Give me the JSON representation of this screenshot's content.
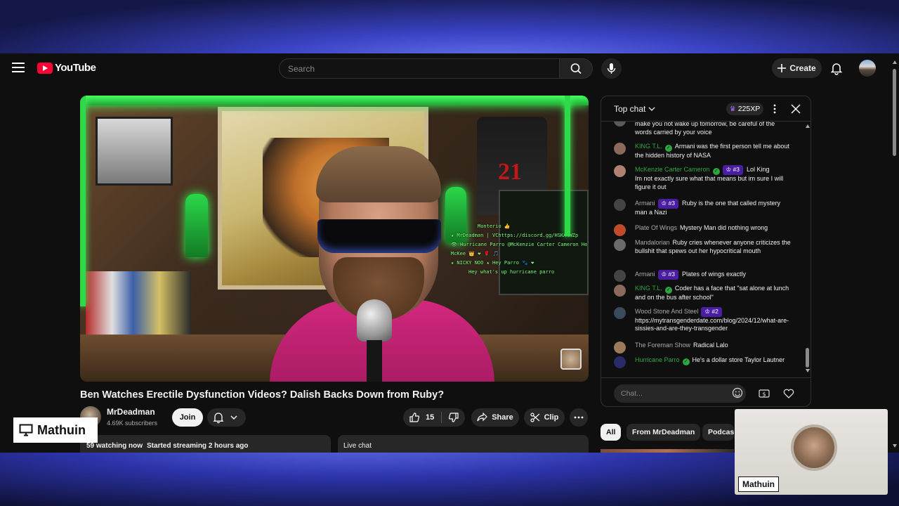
{
  "header": {
    "logo_text": "YouTube",
    "search_placeholder": "Search",
    "create_label": "Create"
  },
  "video": {
    "title": "Ben Watches Erectile Dysfunction Videos? Dalish Backs Down from Ruby?",
    "overlay_lines": [
      "Monterio 👍",
      "★ MrDeadman | VChttps://discord.gg/HSKANWZp",
      "👁 Hurricane Parro @McKenzie Carter Cameron Hello",
      "McKee 👑 ❤ 🌹 🎵",
      "★ NICKY NOO ★   Hey Parro 🐾 ❤",
      "Hey what's up hurricane parro"
    ],
    "jersey_number": "21"
  },
  "channel": {
    "name": "MrDeadman",
    "subscribers": "4.69K subscribers",
    "join_label": "Join"
  },
  "actions": {
    "likes": "15",
    "share_label": "Share",
    "clip_label": "Clip"
  },
  "description": {
    "watching": "59 watching now",
    "started": "Started streaming 2 hours ago"
  },
  "live_chat_label": "Live chat",
  "chat": {
    "mode_label": "Top chat",
    "xp": "225XP",
    "input_placeholder": "Chat...",
    "messages": [
      {
        "author": "",
        "text": "make you not wake up tomorrow, be careful of the words carried by your voice",
        "color": "#5a5a5a"
      },
      {
        "author": "KING T.L.",
        "member": true,
        "verified": true,
        "badge": "",
        "text": "Armani was the first person tell me about the hidden history of NASA",
        "color": "#8a6a5a"
      },
      {
        "author": "McKenzie Carter Cameron",
        "member": true,
        "verified": true,
        "badge": "#3",
        "text": "Lol King",
        "text2": "Im not exactly sure what that means but im sure I will figure it out",
        "color": "#b08070"
      },
      {
        "author": "Armani",
        "member": false,
        "verified": false,
        "badge": "#3",
        "text": "Ruby is the one that called mystery man a Nazi",
        "color": "#444444"
      },
      {
        "author": "Plate Of Wings",
        "member": false,
        "verified": false,
        "badge": "",
        "text": "Mystery Man did nothing wrong",
        "color": "#c04a2a"
      },
      {
        "author": "Mandalorian",
        "member": false,
        "verified": false,
        "badge": "",
        "text": "Ruby cries whenever anyone criticizes the bullshit that spews out her hypocritical mouth",
        "color": "#6a6a6a"
      },
      {
        "author": "Armani",
        "member": false,
        "verified": false,
        "badge": "#3",
        "text": "Plates of wings exactly",
        "color": "#444444"
      },
      {
        "author": "KING T.L.",
        "member": true,
        "verified": true,
        "badge": "",
        "text": "Coder has a face that \"sat alone at lunch and on the bus after school\"",
        "color": "#8a6a5a"
      },
      {
        "author": "Wood Stone And Steel",
        "member": false,
        "verified": false,
        "badge": "#2",
        "text": "https://mytransgenderdate.com/blog/2024/12/what-are-sissies-and-are-they-transgender",
        "color": "#3a4a5a"
      },
      {
        "author": "The Foreman Show",
        "member": false,
        "verified": false,
        "badge": "",
        "text": "Radical Lalo",
        "color": "#9a7a5a"
      },
      {
        "author": "Hurricane Parro",
        "member": true,
        "verified": true,
        "badge": "",
        "text": "He's a dollar store Taylor Lautner",
        "color": "#2a2a6a"
      }
    ]
  },
  "chips": [
    "All",
    "From MrDeadman",
    "Podcast"
  ],
  "overlays": {
    "presenter_label": "Mathuin",
    "cam_label": "Mathuin"
  },
  "colors": {
    "brand_red": "#ff0033",
    "member_green": "#2ba640",
    "badge_purple": "#4a1da3"
  }
}
